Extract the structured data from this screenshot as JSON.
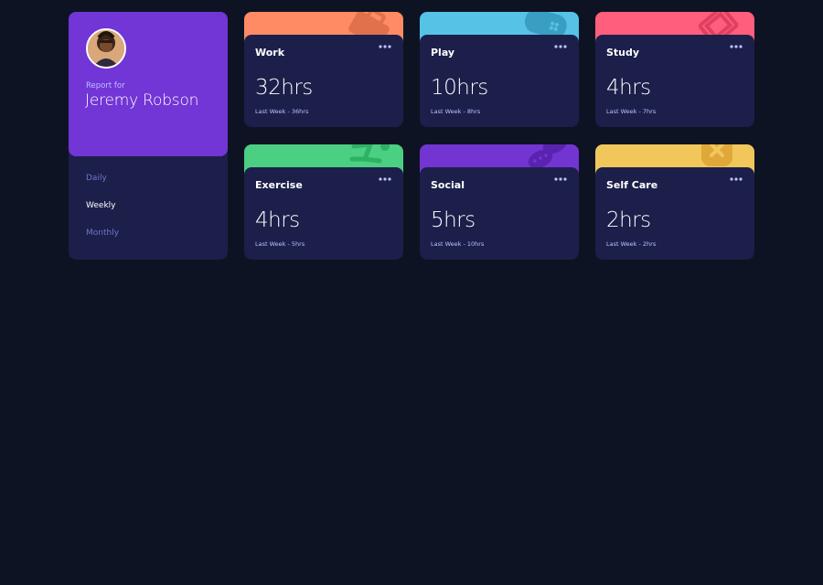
{
  "profile": {
    "report_label": "Report for",
    "name": "Jeremy Robson",
    "avatar_icon": "user-avatar",
    "periods": [
      {
        "label": "Daily",
        "active": false
      },
      {
        "label": "Weekly",
        "active": true
      },
      {
        "label": "Monthly",
        "active": false
      }
    ]
  },
  "cards": [
    {
      "title": "Work",
      "hours": "32hrs",
      "previous": "Last Week - 36hrs",
      "color": "#ff8b64",
      "icon": "briefcase-icon"
    },
    {
      "title": "Play",
      "hours": "10hrs",
      "previous": "Last Week - 8hrs",
      "color": "#55c2e6",
      "icon": "gamepad-icon"
    },
    {
      "title": "Study",
      "hours": "4hrs",
      "previous": "Last Week - 7hrs",
      "color": "#ff5e7d",
      "icon": "book-icon"
    },
    {
      "title": "Exercise",
      "hours": "4hrs",
      "previous": "Last Week - 5hrs",
      "color": "#4bcf82",
      "icon": "running-icon"
    },
    {
      "title": "Social",
      "hours": "5hrs",
      "previous": "Last Week - 10hrs",
      "color": "#7335d2",
      "icon": "chat-bubbles-icon"
    },
    {
      "title": "Self Care",
      "hours": "2hrs",
      "previous": "Last Week - 2hrs",
      "color": "#f1c75b",
      "icon": "bandage-heart-icon"
    }
  ],
  "menu_icon": "ellipsis-icon"
}
